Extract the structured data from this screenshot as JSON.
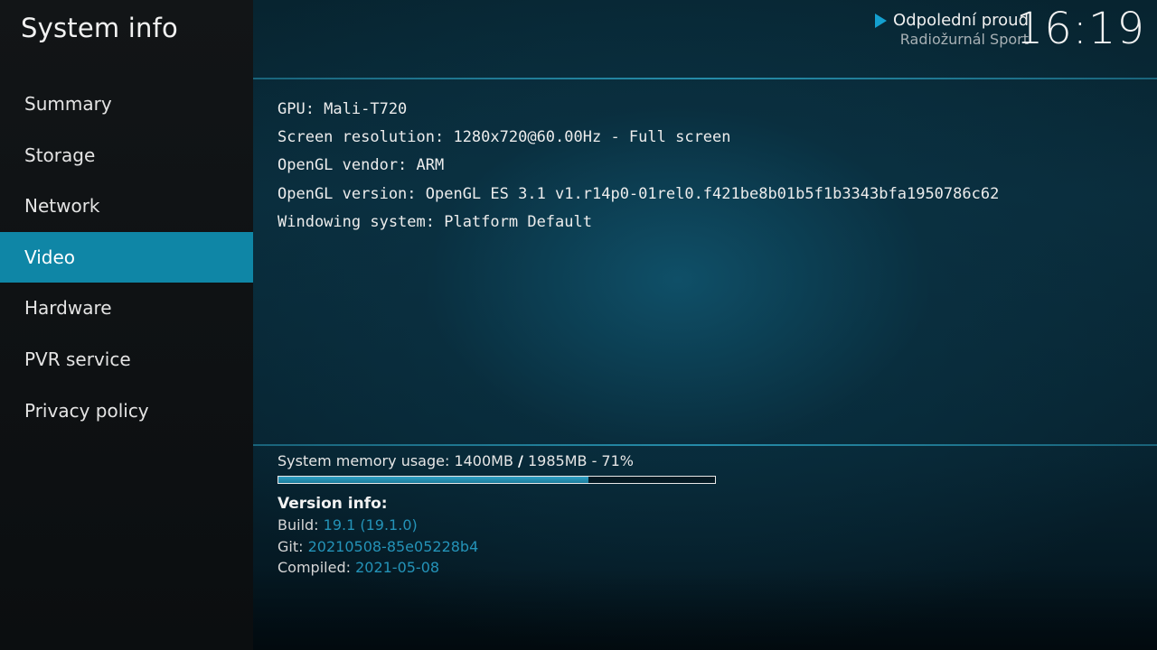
{
  "window": {
    "title": "System info"
  },
  "sidebar": {
    "items": [
      {
        "label": "Summary"
      },
      {
        "label": "Storage"
      },
      {
        "label": "Network"
      },
      {
        "label": "Video"
      },
      {
        "label": "Hardware"
      },
      {
        "label": "PVR service"
      },
      {
        "label": "Privacy policy"
      }
    ],
    "selected_label": "Video"
  },
  "header": {
    "now_playing": {
      "icon": "play-icon",
      "title": "Odpolední proud",
      "subtitle": "Radiožurnál Sport"
    },
    "clock": "16:19"
  },
  "video_info": {
    "lines": [
      "GPU: Mali-T720",
      "Screen resolution: 1280x720@60.00Hz - Full screen",
      "OpenGL vendor: ARM",
      "OpenGL version: OpenGL ES 3.1 v1.r14p0-01rel0.f421be8b01b5f1b3343bfa1950786c62",
      "Windowing system: Platform Default"
    ]
  },
  "memory": {
    "label_prefix": "System memory usage: 1400MB",
    "separator": "/",
    "label_suffix": "1985MB - 71%",
    "percent": 71
  },
  "version": {
    "title": "Version info:",
    "build_label": "Build:",
    "build_value": "19.1 (19.1.0)",
    "git_label": "Git:",
    "git_value": "20210508-85e05228b4",
    "compiled_label": "Compiled:",
    "compiled_value": "2021-05-08"
  },
  "colors": {
    "accent": "#0f86a6",
    "link_value": "#2493b8",
    "play_icon": "#14a0cf"
  }
}
